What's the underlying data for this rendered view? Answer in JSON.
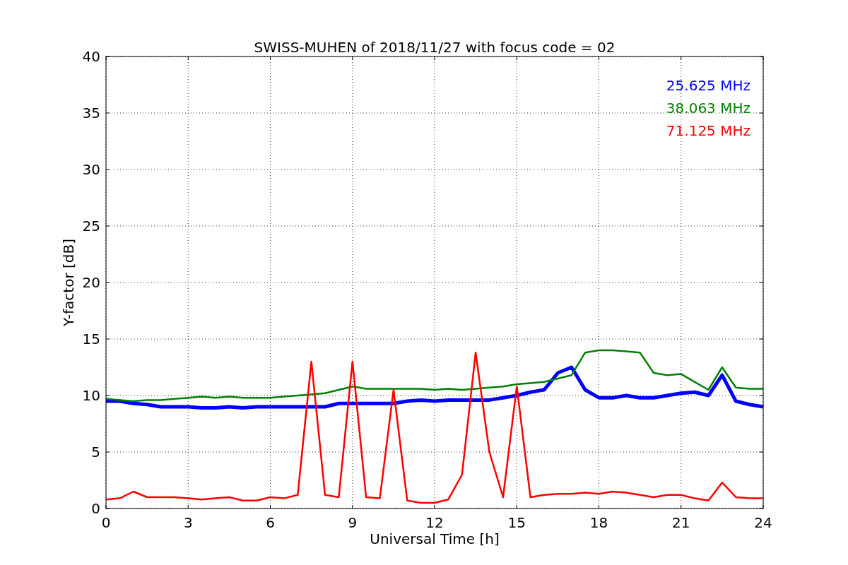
{
  "chart_data": {
    "type": "line",
    "title": "SWISS-MUHEN of 2018/11/27 with focus code = 02",
    "xlabel": "Universal Time [h]",
    "ylabel": "Y-factor [dB]",
    "x": [
      0,
      0.5,
      1,
      1.5,
      2,
      2.5,
      3,
      3.5,
      4,
      4.5,
      5,
      5.5,
      6,
      6.5,
      7,
      7.5,
      8,
      8.5,
      9,
      9.5,
      10,
      10.5,
      11,
      11.5,
      12,
      12.5,
      13,
      13.5,
      14,
      14.5,
      15,
      15.5,
      16,
      16.5,
      17,
      17.5,
      18,
      18.5,
      19,
      19.5,
      20,
      20.5,
      21,
      21.5,
      22,
      22.5,
      23,
      23.5,
      24
    ],
    "series": [
      {
        "name": "25.625 MHz",
        "color": "#0000ff",
        "values": [
          9.5,
          9.5,
          9.3,
          9.2,
          9.0,
          9.0,
          9.0,
          8.9,
          8.9,
          9.0,
          8.9,
          9.0,
          9.0,
          9.0,
          9.0,
          9.0,
          9.0,
          9.3,
          9.3,
          9.3,
          9.3,
          9.3,
          9.5,
          9.6,
          9.5,
          9.6,
          9.6,
          9.6,
          9.6,
          9.8,
          10.0,
          10.3,
          10.5,
          12.0,
          12.5,
          10.5,
          9.8,
          9.8,
          10.0,
          9.8,
          9.8,
          10.0,
          10.2,
          10.3,
          10.0,
          11.8,
          9.5,
          9.2,
          9.0
        ]
      },
      {
        "name": "38.063 MHz",
        "color": "#008000",
        "values": [
          9.7,
          9.6,
          9.5,
          9.6,
          9.6,
          9.7,
          9.8,
          9.9,
          9.8,
          9.9,
          9.8,
          9.8,
          9.8,
          9.9,
          10.0,
          10.1,
          10.2,
          10.5,
          10.8,
          10.6,
          10.6,
          10.6,
          10.6,
          10.6,
          10.5,
          10.6,
          10.5,
          10.6,
          10.7,
          10.8,
          11.0,
          11.1,
          11.2,
          11.5,
          11.8,
          13.8,
          14.0,
          14.0,
          13.9,
          13.8,
          12.0,
          11.8,
          11.9,
          11.2,
          10.5,
          12.5,
          10.7,
          10.6,
          10.6
        ]
      },
      {
        "name": "71.125 MHz",
        "color": "#ff0000",
        "values": [
          0.8,
          0.9,
          1.5,
          1.0,
          1.0,
          1.0,
          0.9,
          0.8,
          0.9,
          1.0,
          0.7,
          0.7,
          1.0,
          0.9,
          1.2,
          13.0,
          1.2,
          1.0,
          13.0,
          1.0,
          0.9,
          10.5,
          0.7,
          0.5,
          0.5,
          0.8,
          3.0,
          13.8,
          5.0,
          1.0,
          10.8,
          1.0,
          1.2,
          1.3,
          1.3,
          1.4,
          1.3,
          1.5,
          1.4,
          1.2,
          1.0,
          1.2,
          1.2,
          0.9,
          0.7,
          2.3,
          1.0,
          0.9,
          0.9
        ]
      }
    ],
    "xlim": [
      0,
      24
    ],
    "ylim": [
      0,
      40
    ],
    "grid": true,
    "xticks": [
      0,
      3,
      6,
      9,
      12,
      15,
      18,
      21,
      24
    ],
    "yticks": [
      0,
      5,
      10,
      15,
      20,
      25,
      30,
      35,
      40
    ]
  }
}
